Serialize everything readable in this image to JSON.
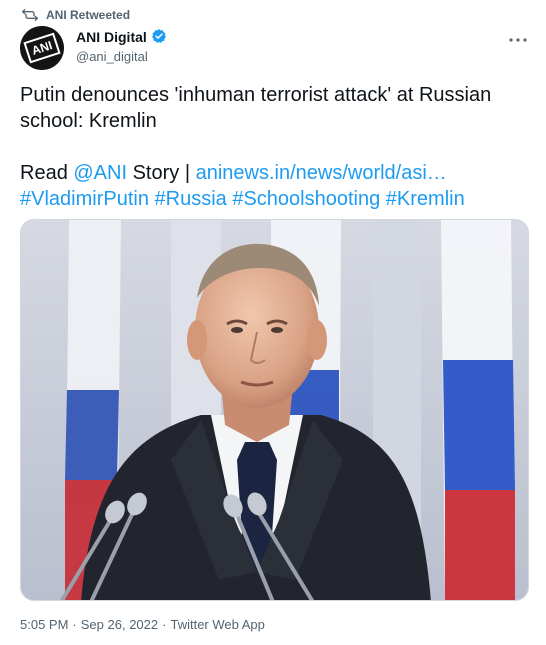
{
  "retweet": {
    "label": "ANI Retweeted"
  },
  "author": {
    "name": "ANI Digital",
    "handle": "@ani_digital",
    "verified": true,
    "avatar_text": "ANI"
  },
  "tweet": {
    "line1": "Putin denounces 'inhuman terrorist attack' at Russian",
    "line2": "school: Kremlin",
    "read_prefix": "Read ",
    "mention": "@ANI",
    "story": " Story | ",
    "link": "aninews.in/news/world/asi…",
    "hashtags": [
      "#VladimirPutin",
      "#Russia",
      "#Schoolshooting",
      "#Kremlin"
    ]
  },
  "media": {
    "image_name": "putin-speaking-at-podium"
  },
  "meta": {
    "time": "5:05 PM",
    "separator": "·",
    "date": "Sep 26, 2022",
    "source": "Twitter Web App"
  },
  "colors": {
    "link": "#1d9bf0",
    "secondary_text": "#536471",
    "primary_text": "#0f1419",
    "verified": "#1d9bf0"
  },
  "icons": {
    "retweet": "retweet-icon",
    "verified": "verified-badge-icon",
    "more": "more-options-icon"
  }
}
